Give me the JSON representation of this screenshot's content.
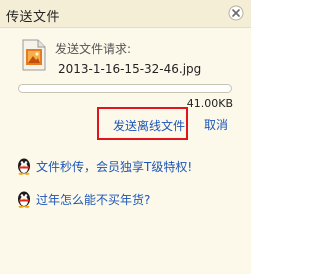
{
  "window": {
    "title": "传送文件"
  },
  "transfer": {
    "request_label": "发送文件请求:",
    "file_name": "2013-1-16-15-32-46.jpg",
    "file_size": "41.00KB",
    "progress_fraction": 0
  },
  "actions": {
    "send_offline_label": "发送离线文件",
    "cancel_label": "取消"
  },
  "promos": [
    {
      "text": "文件秒传，会员独享T级特权!",
      "icon": "qq-penguin-icon"
    },
    {
      "text": "过年怎么能不买年货?",
      "icon": "qq-penguin-icon"
    }
  ],
  "colors": {
    "link": "#1c56b8",
    "highlight_border": "#e0141d",
    "panel_bg": "#fdf9ea",
    "title_bg": "#f5eed6"
  }
}
